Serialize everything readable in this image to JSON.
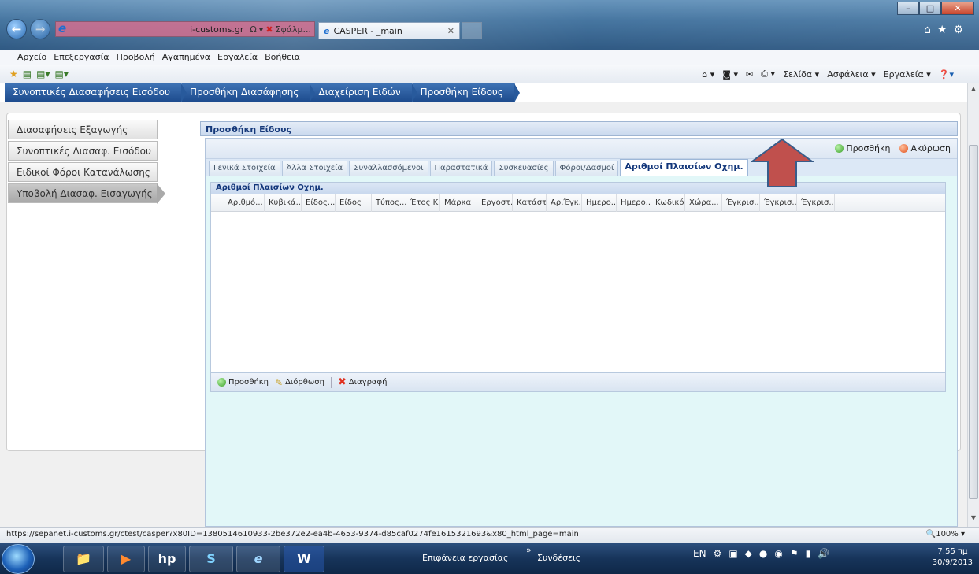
{
  "browser": {
    "address_url": "i-customs.gr",
    "address_tools": [
      "Ω",
      "▾",
      "✖",
      "Σφάλμ..."
    ],
    "tab_title": "CASPER - _main",
    "menu": [
      "Αρχείο",
      "Επεξεργασία",
      "Προβολή",
      "Αγαπημένα",
      "Εργαλεία",
      "Βοήθεια"
    ],
    "command_right": [
      "Σελίδα ▾",
      "Ασφάλεια ▾",
      "Εργαλεία ▾"
    ],
    "status_url": "https://sepanet.i-customs.gr/ctest/casper?x80ID=1380514610933-2be372e2-ea4b-4653-9374-d85caf0274fe1615321693&x80_html_page=main",
    "zoom": "100%"
  },
  "breadcrumb": [
    "Συνοπτικές Διασαφήσεις Εισόδου",
    "Προσθήκη Διασάφησης",
    "Διαχείριση Ειδών",
    "Προσθήκη Είδους"
  ],
  "sidebar": [
    "Διασαφήσεις Εξαγωγής",
    "Συνοπτικές Διασαφ. Εισόδου",
    "Ειδικοί Φόροι Κατανάλωσης",
    "Υποβολή Διασαφ. Εισαγωγής"
  ],
  "form": {
    "title": "Προσθήκη Είδους",
    "add_label": "Προσθήκη",
    "cancel_label": "Ακύρωση",
    "tabs": [
      "Γενικά Στοιχεία",
      "Άλλα Στοιχεία",
      "Συναλλασσόμενοι",
      "Παραστατικά",
      "Συσκευασίες",
      "Φόροι/Δασμοί",
      "Αριθμοί Πλαισίων Οχημ."
    ],
    "grid_title": "Αριθμοί Πλαισίων Οχημ.",
    "columns": [
      "Αριθμό...",
      "Κυβικά...",
      "Είδος...",
      "Είδος",
      "Τύπος...",
      "Έτος Κ...",
      "Μάρκα",
      "Εργοστ...",
      "Κατάστ...",
      "Αρ.Έγκ...",
      "Ημερο...",
      "Ημερο...",
      "Κωδικό...",
      "Χώρα...",
      "Έγκρισ...",
      "Έγκρισ...",
      "Έγκρισ..."
    ],
    "grid_actions": {
      "add": "Προσθήκη",
      "edit": "Διόρθωση",
      "delete": "Διαγραφή"
    }
  },
  "annotation": {
    "arrow_color": "#c0504d",
    "arrow_outline": "#385d8a"
  },
  "taskbar": {
    "desktop_label": "Επιφάνεια εργασίας",
    "connections_label": "Συνδέσεις",
    "lang": "EN",
    "time": "7:55 πμ",
    "date": "30/9/2013"
  }
}
